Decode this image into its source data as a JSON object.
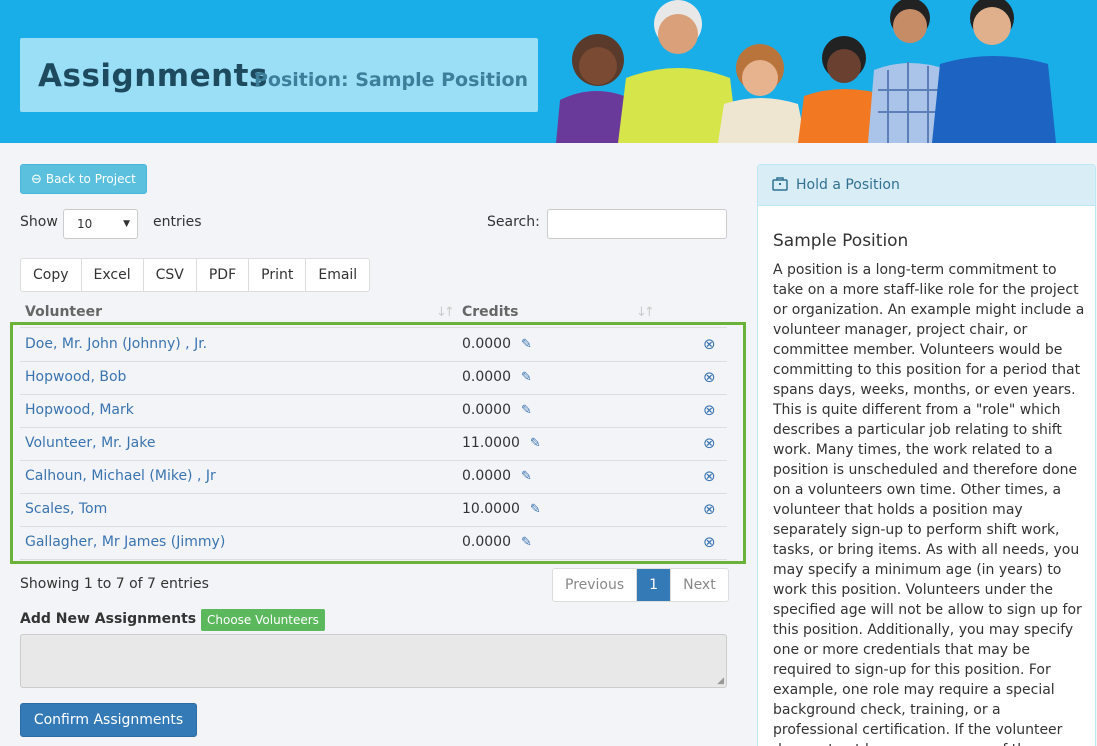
{
  "header": {
    "title": "Assignments",
    "subtitle": "Position: Sample Position"
  },
  "back_button": {
    "label": "Back to Project",
    "icon": "circle-arrow-left-icon"
  },
  "table_controls": {
    "show_label": "Show",
    "entries_value": "10",
    "entries_label": "entries",
    "search_label": "Search:",
    "search_value": ""
  },
  "export_buttons": [
    "Copy",
    "Excel",
    "CSV",
    "PDF",
    "Print",
    "Email"
  ],
  "columns": [
    "Volunteer",
    "Credits"
  ],
  "rows": [
    {
      "name": "Doe, Mr. John (Johnny) , Jr.",
      "credits": "0.0000"
    },
    {
      "name": "Hopwood, Bob",
      "credits": "0.0000"
    },
    {
      "name": "Hopwood, Mark",
      "credits": "0.0000"
    },
    {
      "name": "Volunteer, Mr. Jake",
      "credits": "11.0000"
    },
    {
      "name": "Calhoun, Michael (Mike) , Jr",
      "credits": "0.0000"
    },
    {
      "name": "Scales, Tom",
      "credits": "10.0000"
    },
    {
      "name": "Gallagher, Mr James (Jimmy)",
      "credits": "0.0000"
    }
  ],
  "table_info": "Showing 1 to 7 of 7 entries",
  "pagination": {
    "previous": "Previous",
    "current": "1",
    "next": "Next"
  },
  "add_assignments": {
    "label": "Add New Assignments",
    "choose_button": "Choose Volunteers",
    "confirm_button": "Confirm Assignments"
  },
  "panel": {
    "heading": "Hold a Position",
    "heading_icon": "briefcase-icon",
    "title": "Sample Position",
    "body": "A position is a long-term commitment to take on a more staff-like role for the project or organization. An example might include a volunteer manager, project chair, or committee member. Volunteers would be committing to this position for a period that spans days, weeks, months, or even years. This is quite different from a \"role\" which describes a particular job relating to shift work. Many times, the work related to a position is unscheduled and therefore done on a volunteers own time. Other times, a volunteer that holds a position may separately sign-up to perform shift work, tasks, or bring items. As with all needs, you may specify a minimum age (in years) to work this position. Volunteers under the specified age will not be allow to sign up for this position. Additionally, you may specify one or more credentials that may be required to sign-up for this position. For example, one role may require a special background check, training, or a professional certification. If the volunteer does not yet have one or more of the"
  },
  "colors": {
    "banner": "#1aaee9",
    "title_box": "#9adff6",
    "link": "#3a74b0",
    "info_button": "#5bc0de",
    "success_button": "#5cb85c",
    "primary_button": "#337ab7",
    "highlight_border": "#6ab23a"
  }
}
